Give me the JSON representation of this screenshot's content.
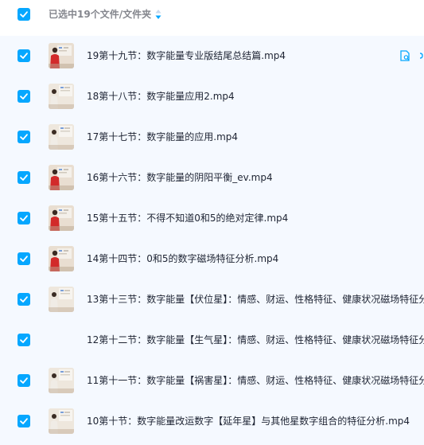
{
  "header": {
    "selection_text": "已选中19个文件/文件夹",
    "checked": true
  },
  "files": [
    {
      "name": "19第十九节：数字能量专业版结尾总结篇.mp4",
      "checked": true,
      "thumb": "video-red"
    },
    {
      "name": "18第十八节：数字能量应用2.mp4",
      "checked": true,
      "thumb": "video-light"
    },
    {
      "name": "17第十七节：数字能量的应用.mp4",
      "checked": true,
      "thumb": "video-light"
    },
    {
      "name": "16第十六节：数字能量的阴阳平衡_ev.mp4",
      "checked": true,
      "thumb": "video-red"
    },
    {
      "name": "15第十五节：不得不知道0和5的绝对定律.mp4",
      "checked": true,
      "thumb": "video-red"
    },
    {
      "name": "14第十四节：0和5的数字磁场特征分析.mp4",
      "checked": true,
      "thumb": "video-red"
    },
    {
      "name": "13第十三节：数字能量【伏位星】：情感、财运、性格特征、健康状况磁场特征分",
      "checked": true,
      "thumb": "video-light"
    },
    {
      "name": "12第十二节：数字能量【生气星】：情感、财运、性格特征、健康状况磁场特征分",
      "checked": true,
      "thumb": "none"
    },
    {
      "name": "11第十一节：数字能量【祸害星】：情感、财运、性格特征、健康状况磁场特征分",
      "checked": true,
      "thumb": "video-light"
    },
    {
      "name": "10第十节：数字能量改运数字【延年星】与其他星数字组合的特征分析.mp4",
      "checked": true,
      "thumb": "video-light"
    }
  ],
  "row_actions": [
    "copy-file-icon",
    "link-icon"
  ],
  "colors": {
    "accent": "#06a7ff",
    "list_background": "#f5f9ff",
    "text": "#1e2433",
    "muted": "#84868d"
  }
}
